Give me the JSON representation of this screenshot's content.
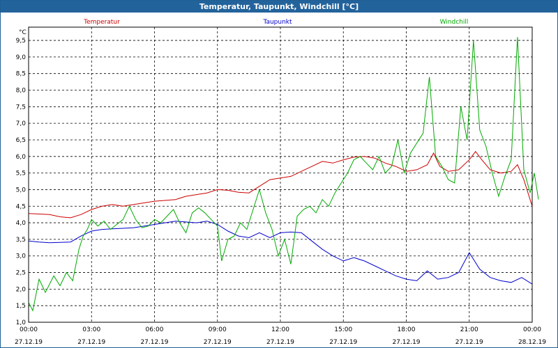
{
  "window": {
    "title": "Temperatur, Taupunkt, Windchill [°C]"
  },
  "chart_data": {
    "type": "line",
    "title": "Temperatur, Taupunkt, Windchill [°C]",
    "ylabel": "°C",
    "ylim": [
      1.0,
      9.9
    ],
    "yticks": [
      1.0,
      1.5,
      2.0,
      2.5,
      3.0,
      3.5,
      4.0,
      4.5,
      5.0,
      5.5,
      6.0,
      6.5,
      7.0,
      7.5,
      8.0,
      8.5,
      9.0,
      9.5
    ],
    "ytick_labels": [
      "1,0",
      "1,5",
      "2,0",
      "2,5",
      "3,0",
      "3,5",
      "4,0",
      "4,5",
      "5,0",
      "5,5",
      "6,0",
      "6,5",
      "7,0",
      "7,5",
      "8,0",
      "8,5",
      "9,0",
      "9,5"
    ],
    "xlim": [
      0,
      24
    ],
    "xticks": [
      0,
      3,
      6,
      9,
      12,
      15,
      18,
      21,
      24
    ],
    "xtick_labels": [
      {
        "time": "00:00",
        "date": "27.12.19"
      },
      {
        "time": "03:00",
        "date": "27.12.19"
      },
      {
        "time": "06:00",
        "date": "27.12.19"
      },
      {
        "time": "09:00",
        "date": "27.12.19"
      },
      {
        "time": "12:00",
        "date": "27.12.19"
      },
      {
        "time": "15:00",
        "date": "27.12.19"
      },
      {
        "time": "18:00",
        "date": "27.12.19"
      },
      {
        "time": "21:00",
        "date": "27.12.19"
      },
      {
        "time": "00:00",
        "date": "28.12.19"
      }
    ],
    "grid": true,
    "legend": "top",
    "series": [
      {
        "name": "Temperatur",
        "color": "#cc0000",
        "points": [
          [
            0,
            4.28
          ],
          [
            1,
            4.25
          ],
          [
            1.5,
            4.18
          ],
          [
            2,
            4.15
          ],
          [
            2.5,
            4.25
          ],
          [
            3,
            4.4
          ],
          [
            3.5,
            4.5
          ],
          [
            4,
            4.55
          ],
          [
            4.5,
            4.5
          ],
          [
            5,
            4.55
          ],
          [
            5.5,
            4.6
          ],
          [
            6,
            4.65
          ],
          [
            7,
            4.7
          ],
          [
            7.5,
            4.8
          ],
          [
            8,
            4.85
          ],
          [
            8.5,
            4.9
          ],
          [
            9,
            5.0
          ],
          [
            9.5,
            4.98
          ],
          [
            10,
            4.92
          ],
          [
            10.5,
            4.9
          ],
          [
            11,
            5.1
          ],
          [
            11.5,
            5.3
          ],
          [
            12,
            5.35
          ],
          [
            12.5,
            5.4
          ],
          [
            13,
            5.55
          ],
          [
            13.5,
            5.7
          ],
          [
            14,
            5.85
          ],
          [
            14.5,
            5.8
          ],
          [
            15,
            5.9
          ],
          [
            15.5,
            5.98
          ],
          [
            16,
            6.0
          ],
          [
            16.5,
            5.95
          ],
          [
            17,
            5.8
          ],
          [
            17.5,
            5.7
          ],
          [
            18,
            5.55
          ],
          [
            18.5,
            5.6
          ],
          [
            19,
            5.75
          ],
          [
            19.3,
            6.1
          ],
          [
            19.6,
            5.7
          ],
          [
            20,
            5.55
          ],
          [
            20.5,
            5.6
          ],
          [
            21,
            5.9
          ],
          [
            21.3,
            6.15
          ],
          [
            21.6,
            5.9
          ],
          [
            22,
            5.6
          ],
          [
            22.5,
            5.5
          ],
          [
            23,
            5.55
          ],
          [
            23.3,
            5.75
          ],
          [
            23.6,
            5.3
          ],
          [
            24,
            4.5
          ]
        ]
      },
      {
        "name": "Taupunkt",
        "color": "#0000cc",
        "points": [
          [
            0,
            3.45
          ],
          [
            0.5,
            3.42
          ],
          [
            1,
            3.4
          ],
          [
            2,
            3.42
          ],
          [
            2.5,
            3.6
          ],
          [
            3,
            3.75
          ],
          [
            3.5,
            3.8
          ],
          [
            4,
            3.82
          ],
          [
            5,
            3.85
          ],
          [
            6,
            3.95
          ],
          [
            7,
            4.05
          ],
          [
            8,
            4.0
          ],
          [
            8.5,
            4.05
          ],
          [
            9,
            3.95
          ],
          [
            9.5,
            3.75
          ],
          [
            10,
            3.6
          ],
          [
            10.5,
            3.55
          ],
          [
            11,
            3.7
          ],
          [
            11.5,
            3.55
          ],
          [
            12,
            3.7
          ],
          [
            12.5,
            3.72
          ],
          [
            13,
            3.7
          ],
          [
            13.5,
            3.45
          ],
          [
            14,
            3.2
          ],
          [
            14.5,
            3.0
          ],
          [
            15,
            2.85
          ],
          [
            15.5,
            2.95
          ],
          [
            16,
            2.85
          ],
          [
            16.5,
            2.7
          ],
          [
            17,
            2.55
          ],
          [
            17.5,
            2.4
          ],
          [
            18,
            2.3
          ],
          [
            18.5,
            2.25
          ],
          [
            19,
            2.55
          ],
          [
            19.5,
            2.3
          ],
          [
            20,
            2.35
          ],
          [
            20.5,
            2.5
          ],
          [
            21,
            3.1
          ],
          [
            21.5,
            2.6
          ],
          [
            22,
            2.35
          ],
          [
            22.5,
            2.25
          ],
          [
            23,
            2.2
          ],
          [
            23.5,
            2.35
          ],
          [
            24,
            2.15
          ]
        ]
      },
      {
        "name": "Windchill",
        "color": "#00aa00",
        "points": [
          [
            0,
            1.6
          ],
          [
            0.2,
            1.35
          ],
          [
            0.5,
            2.3
          ],
          [
            0.8,
            1.9
          ],
          [
            1.2,
            2.4
          ],
          [
            1.5,
            2.1
          ],
          [
            1.8,
            2.5
          ],
          [
            2.1,
            2.25
          ],
          [
            2.4,
            3.2
          ],
          [
            2.6,
            3.6
          ],
          [
            2.8,
            3.8
          ],
          [
            3.0,
            4.1
          ],
          [
            3.3,
            3.9
          ],
          [
            3.6,
            4.05
          ],
          [
            3.9,
            3.8
          ],
          [
            4.2,
            3.95
          ],
          [
            4.5,
            4.1
          ],
          [
            4.8,
            4.5
          ],
          [
            5.1,
            4.1
          ],
          [
            5.4,
            3.85
          ],
          [
            5.7,
            3.9
          ],
          [
            6.0,
            4.1
          ],
          [
            6.3,
            4.0
          ],
          [
            6.6,
            4.2
          ],
          [
            6.9,
            4.4
          ],
          [
            7.2,
            4.0
          ],
          [
            7.5,
            3.7
          ],
          [
            7.8,
            4.3
          ],
          [
            8.1,
            4.45
          ],
          [
            8.4,
            4.3
          ],
          [
            8.7,
            4.1
          ],
          [
            9.0,
            3.9
          ],
          [
            9.2,
            2.85
          ],
          [
            9.5,
            3.5
          ],
          [
            9.8,
            3.6
          ],
          [
            10.1,
            4.0
          ],
          [
            10.4,
            3.8
          ],
          [
            10.7,
            4.4
          ],
          [
            11,
            5.0
          ],
          [
            11.3,
            4.3
          ],
          [
            11.6,
            3.8
          ],
          [
            11.9,
            3.0
          ],
          [
            12.2,
            3.5
          ],
          [
            12.5,
            2.75
          ],
          [
            12.8,
            4.2
          ],
          [
            13.1,
            4.4
          ],
          [
            13.4,
            4.5
          ],
          [
            13.7,
            4.3
          ],
          [
            14.0,
            4.7
          ],
          [
            14.3,
            4.5
          ],
          [
            14.6,
            4.9
          ],
          [
            14.9,
            5.2
          ],
          [
            15.2,
            5.5
          ],
          [
            15.5,
            5.9
          ],
          [
            15.8,
            6.0
          ],
          [
            16.1,
            5.8
          ],
          [
            16.4,
            5.6
          ],
          [
            16.7,
            6.0
          ],
          [
            17.0,
            5.5
          ],
          [
            17.3,
            5.7
          ],
          [
            17.6,
            6.5
          ],
          [
            17.9,
            5.5
          ],
          [
            18.2,
            6.1
          ],
          [
            18.5,
            6.4
          ],
          [
            18.8,
            6.7
          ],
          [
            19.1,
            8.4
          ],
          [
            19.4,
            6.0
          ],
          [
            19.7,
            5.7
          ],
          [
            20.0,
            5.3
          ],
          [
            20.3,
            5.2
          ],
          [
            20.6,
            7.5
          ],
          [
            20.9,
            6.5
          ],
          [
            21.2,
            9.5
          ],
          [
            21.5,
            6.8
          ],
          [
            21.8,
            6.3
          ],
          [
            22.1,
            5.5
          ],
          [
            22.4,
            4.8
          ],
          [
            22.7,
            5.4
          ],
          [
            23.0,
            5.9
          ],
          [
            23.3,
            9.6
          ],
          [
            23.6,
            5.6
          ],
          [
            23.9,
            4.9
          ],
          [
            24.1,
            5.5
          ],
          [
            24.3,
            4.7
          ]
        ]
      }
    ]
  }
}
